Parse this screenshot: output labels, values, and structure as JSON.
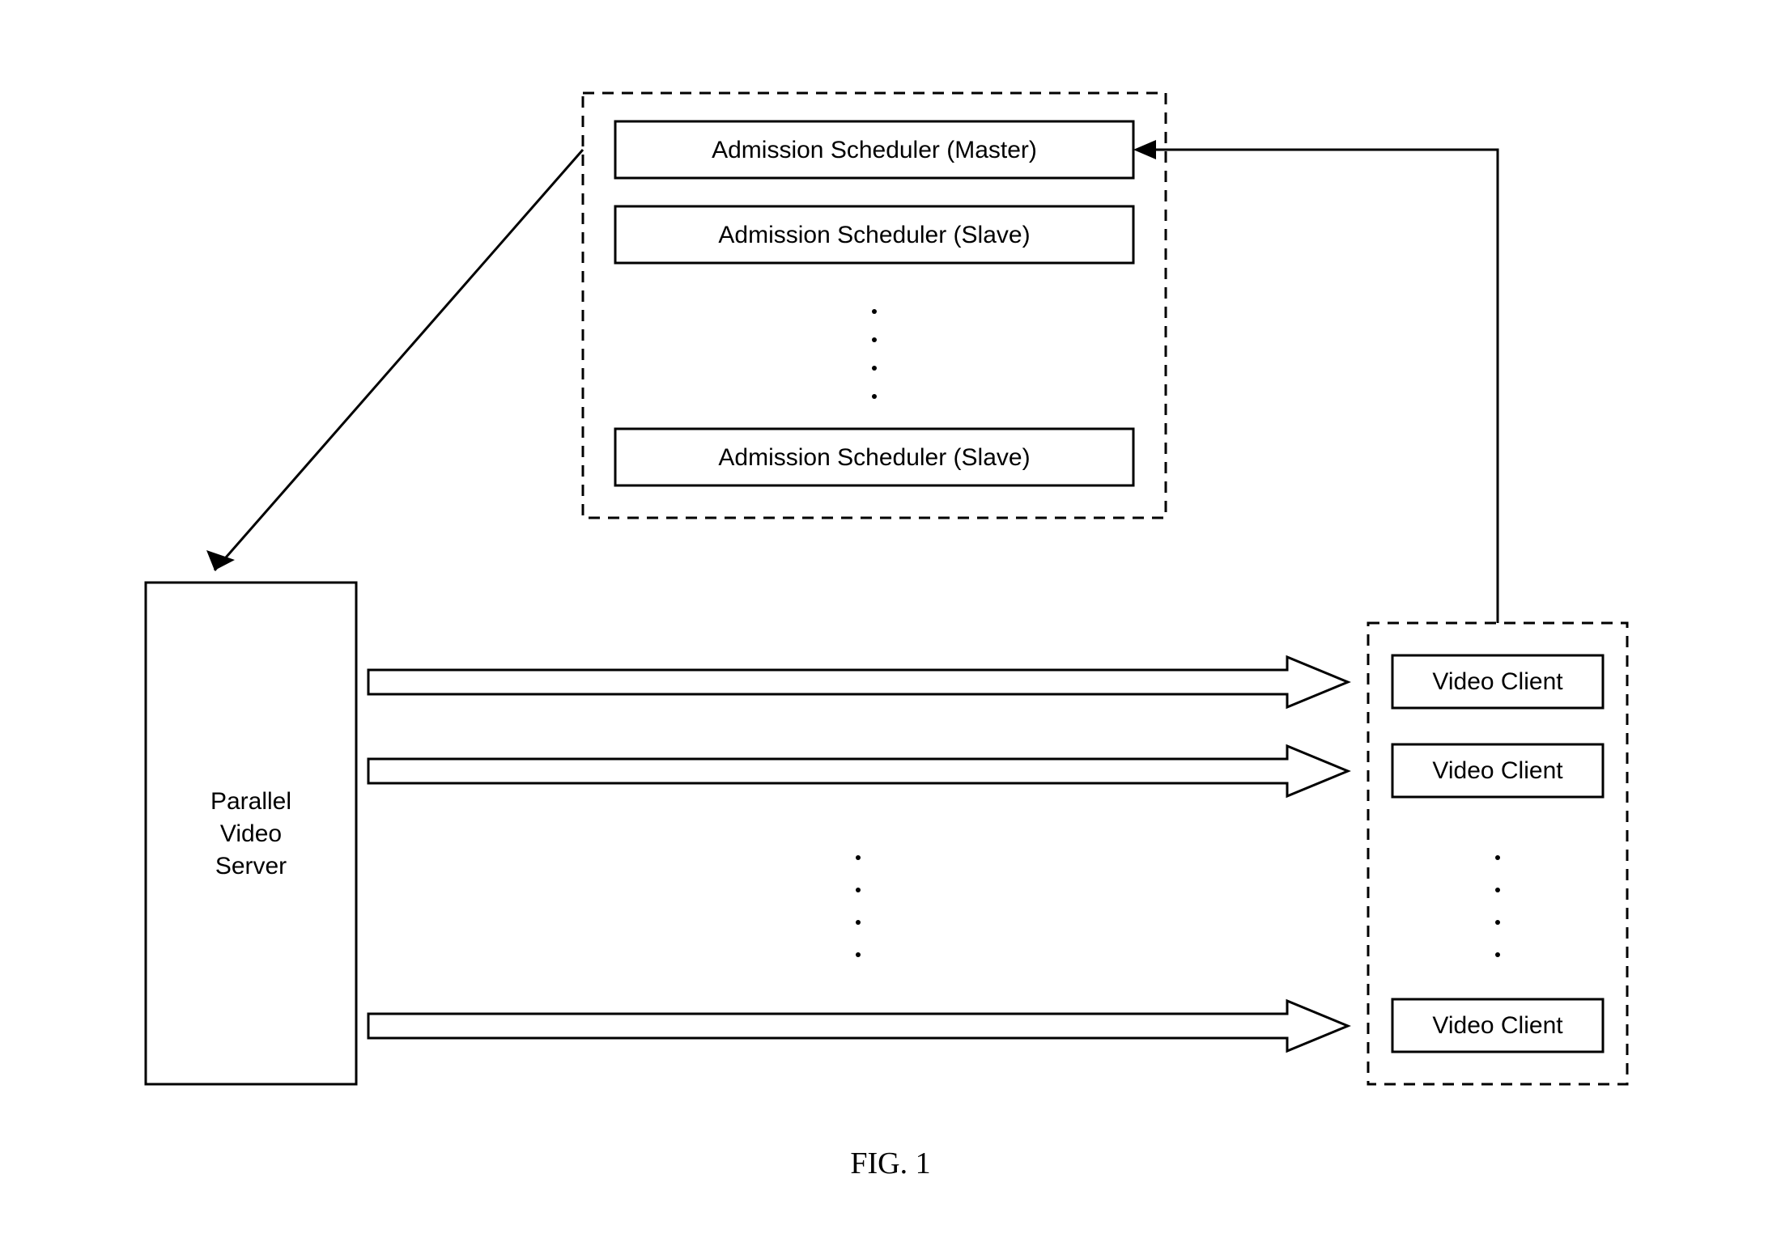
{
  "schedulers": {
    "master": "Admission Scheduler (Master)",
    "slave1": "Admission Scheduler (Slave)",
    "slaveN": "Admission Scheduler (Slave)"
  },
  "server": {
    "line1": "Parallel",
    "line2": "Video",
    "line3": "Server"
  },
  "clients": {
    "c1": "Video Client",
    "c2": "Video Client",
    "cN": "Video Client"
  },
  "caption": "FIG. 1"
}
